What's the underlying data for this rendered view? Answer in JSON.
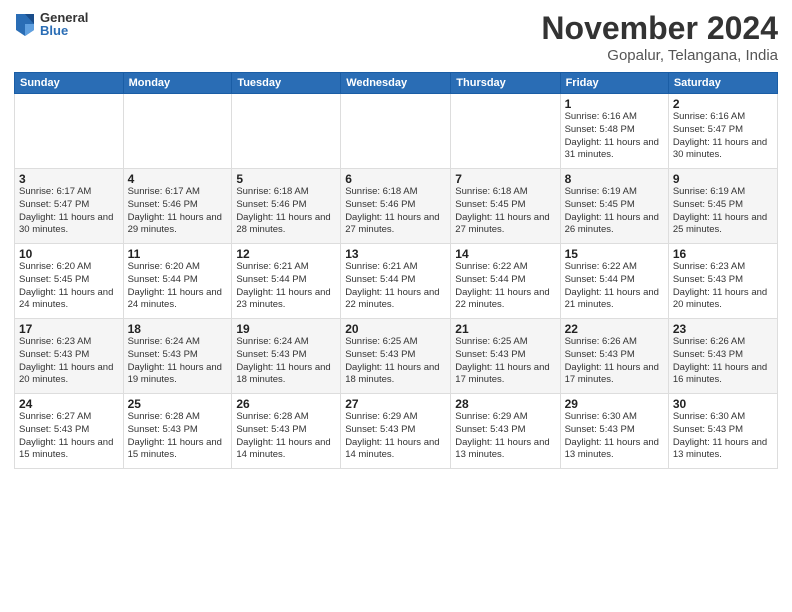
{
  "logo": {
    "general": "General",
    "blue": "Blue"
  },
  "title": "November 2024",
  "location": "Gopalur, Telangana, India",
  "weekdays": [
    "Sunday",
    "Monday",
    "Tuesday",
    "Wednesday",
    "Thursday",
    "Friday",
    "Saturday"
  ],
  "weeks": [
    [
      {
        "day": "",
        "info": ""
      },
      {
        "day": "",
        "info": ""
      },
      {
        "day": "",
        "info": ""
      },
      {
        "day": "",
        "info": ""
      },
      {
        "day": "",
        "info": ""
      },
      {
        "day": "1",
        "info": "Sunrise: 6:16 AM\nSunset: 5:48 PM\nDaylight: 11 hours and 31 minutes."
      },
      {
        "day": "2",
        "info": "Sunrise: 6:16 AM\nSunset: 5:47 PM\nDaylight: 11 hours and 30 minutes."
      }
    ],
    [
      {
        "day": "3",
        "info": "Sunrise: 6:17 AM\nSunset: 5:47 PM\nDaylight: 11 hours and 30 minutes."
      },
      {
        "day": "4",
        "info": "Sunrise: 6:17 AM\nSunset: 5:46 PM\nDaylight: 11 hours and 29 minutes."
      },
      {
        "day": "5",
        "info": "Sunrise: 6:18 AM\nSunset: 5:46 PM\nDaylight: 11 hours and 28 minutes."
      },
      {
        "day": "6",
        "info": "Sunrise: 6:18 AM\nSunset: 5:46 PM\nDaylight: 11 hours and 27 minutes."
      },
      {
        "day": "7",
        "info": "Sunrise: 6:18 AM\nSunset: 5:45 PM\nDaylight: 11 hours and 27 minutes."
      },
      {
        "day": "8",
        "info": "Sunrise: 6:19 AM\nSunset: 5:45 PM\nDaylight: 11 hours and 26 minutes."
      },
      {
        "day": "9",
        "info": "Sunrise: 6:19 AM\nSunset: 5:45 PM\nDaylight: 11 hours and 25 minutes."
      }
    ],
    [
      {
        "day": "10",
        "info": "Sunrise: 6:20 AM\nSunset: 5:45 PM\nDaylight: 11 hours and 24 minutes."
      },
      {
        "day": "11",
        "info": "Sunrise: 6:20 AM\nSunset: 5:44 PM\nDaylight: 11 hours and 24 minutes."
      },
      {
        "day": "12",
        "info": "Sunrise: 6:21 AM\nSunset: 5:44 PM\nDaylight: 11 hours and 23 minutes."
      },
      {
        "day": "13",
        "info": "Sunrise: 6:21 AM\nSunset: 5:44 PM\nDaylight: 11 hours and 22 minutes."
      },
      {
        "day": "14",
        "info": "Sunrise: 6:22 AM\nSunset: 5:44 PM\nDaylight: 11 hours and 22 minutes."
      },
      {
        "day": "15",
        "info": "Sunrise: 6:22 AM\nSunset: 5:44 PM\nDaylight: 11 hours and 21 minutes."
      },
      {
        "day": "16",
        "info": "Sunrise: 6:23 AM\nSunset: 5:43 PM\nDaylight: 11 hours and 20 minutes."
      }
    ],
    [
      {
        "day": "17",
        "info": "Sunrise: 6:23 AM\nSunset: 5:43 PM\nDaylight: 11 hours and 20 minutes."
      },
      {
        "day": "18",
        "info": "Sunrise: 6:24 AM\nSunset: 5:43 PM\nDaylight: 11 hours and 19 minutes."
      },
      {
        "day": "19",
        "info": "Sunrise: 6:24 AM\nSunset: 5:43 PM\nDaylight: 11 hours and 18 minutes."
      },
      {
        "day": "20",
        "info": "Sunrise: 6:25 AM\nSunset: 5:43 PM\nDaylight: 11 hours and 18 minutes."
      },
      {
        "day": "21",
        "info": "Sunrise: 6:25 AM\nSunset: 5:43 PM\nDaylight: 11 hours and 17 minutes."
      },
      {
        "day": "22",
        "info": "Sunrise: 6:26 AM\nSunset: 5:43 PM\nDaylight: 11 hours and 17 minutes."
      },
      {
        "day": "23",
        "info": "Sunrise: 6:26 AM\nSunset: 5:43 PM\nDaylight: 11 hours and 16 minutes."
      }
    ],
    [
      {
        "day": "24",
        "info": "Sunrise: 6:27 AM\nSunset: 5:43 PM\nDaylight: 11 hours and 15 minutes."
      },
      {
        "day": "25",
        "info": "Sunrise: 6:28 AM\nSunset: 5:43 PM\nDaylight: 11 hours and 15 minutes."
      },
      {
        "day": "26",
        "info": "Sunrise: 6:28 AM\nSunset: 5:43 PM\nDaylight: 11 hours and 14 minutes."
      },
      {
        "day": "27",
        "info": "Sunrise: 6:29 AM\nSunset: 5:43 PM\nDaylight: 11 hours and 14 minutes."
      },
      {
        "day": "28",
        "info": "Sunrise: 6:29 AM\nSunset: 5:43 PM\nDaylight: 11 hours and 13 minutes."
      },
      {
        "day": "29",
        "info": "Sunrise: 6:30 AM\nSunset: 5:43 PM\nDaylight: 11 hours and 13 minutes."
      },
      {
        "day": "30",
        "info": "Sunrise: 6:30 AM\nSunset: 5:43 PM\nDaylight: 11 hours and 13 minutes."
      }
    ]
  ]
}
